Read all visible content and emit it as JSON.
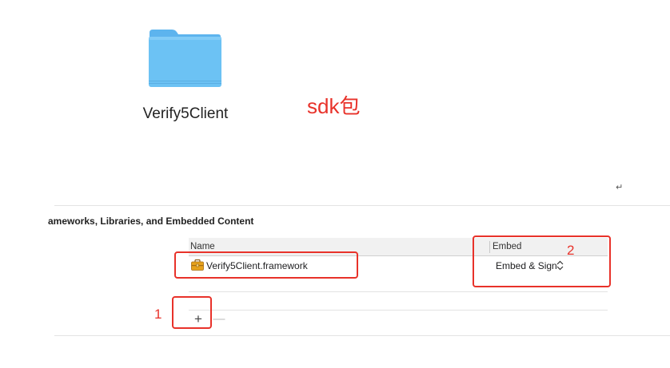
{
  "folder": {
    "label": "Verify5Client",
    "icon": "folder-icon",
    "color": "#6cc2f4"
  },
  "annotations": {
    "sdk_label": "sdk包",
    "step1": "1",
    "step2": "2",
    "color": "#e8322a"
  },
  "return_mark": "↵",
  "section": {
    "title": "ameworks, Libraries, and Embedded Content"
  },
  "table": {
    "columns": [
      "Name",
      "Embed"
    ],
    "rows": [
      {
        "icon": "framework-toolbox-icon",
        "name": "Verify5Client.framework",
        "embed": "Embed & Sign"
      }
    ]
  },
  "controls": {
    "add": "+",
    "remove": "—"
  }
}
